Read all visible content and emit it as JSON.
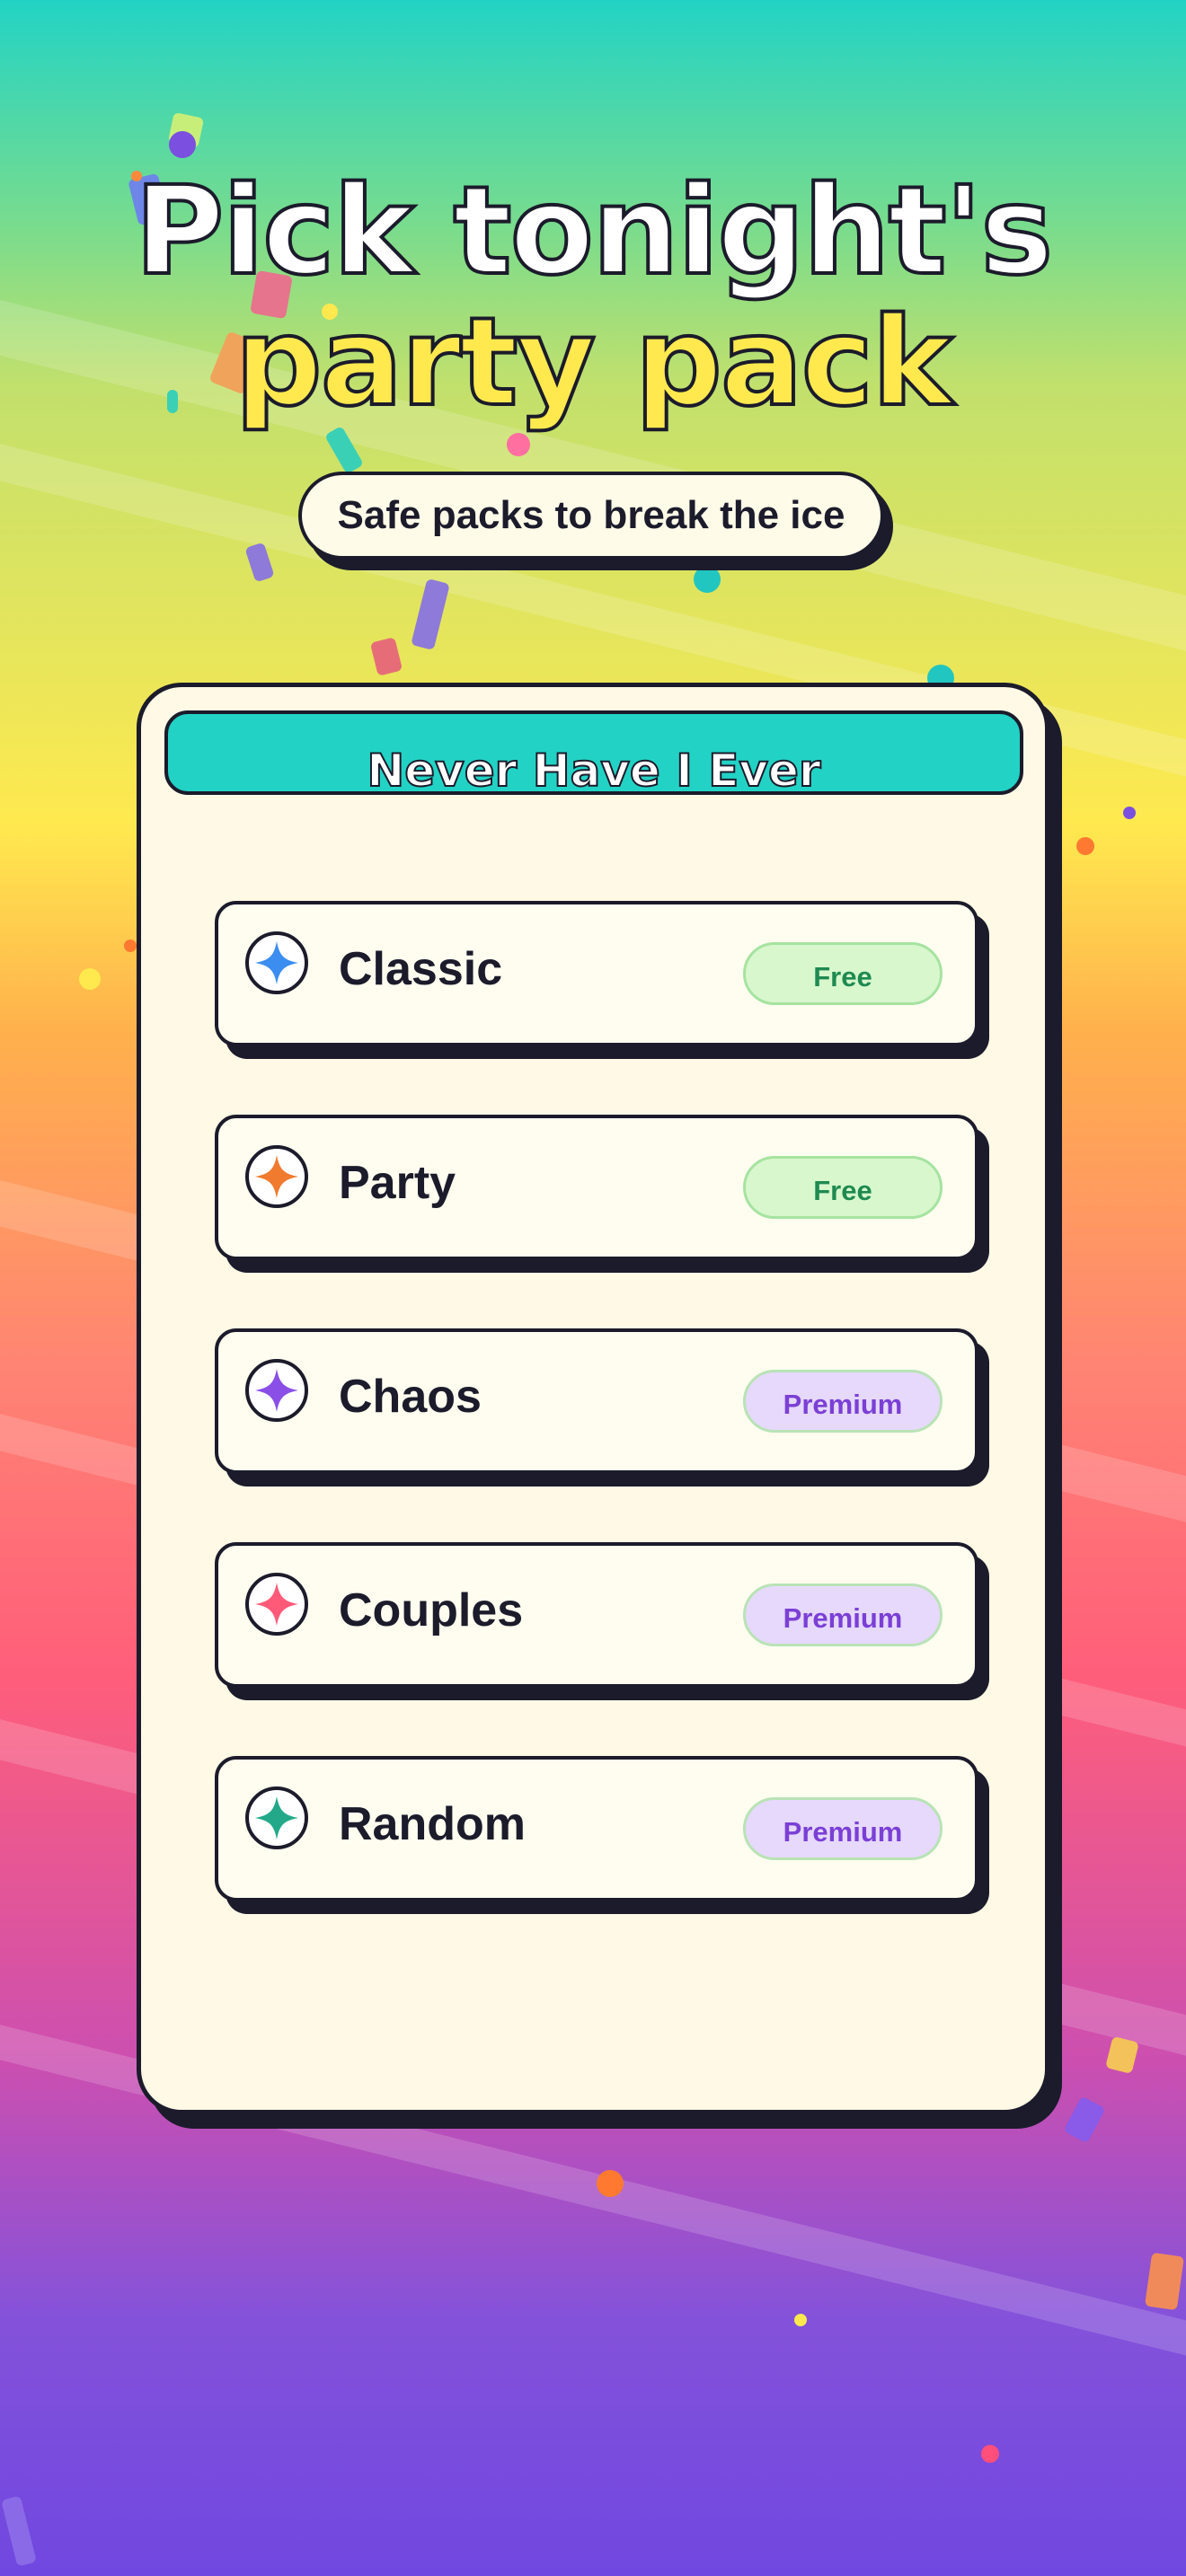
{
  "header": {
    "title_line1": "Pick tonight's",
    "title_line2": "party pack",
    "subtitle": "Safe packs to break the ice"
  },
  "panel": {
    "title": "Never Have I Ever"
  },
  "packs": [
    {
      "name": "Classic",
      "badge": "Free",
      "tier": "free",
      "icon": "sparkle-icon",
      "icon_color": "#3b8df0"
    },
    {
      "name": "Party",
      "badge": "Free",
      "tier": "free",
      "icon": "sparkle-icon",
      "icon_color": "#f07a2e"
    },
    {
      "name": "Chaos",
      "badge": "Premium",
      "tier": "premium",
      "icon": "sparkle-icon",
      "icon_color": "#8a4fe6"
    },
    {
      "name": "Couples",
      "badge": "Premium",
      "tier": "premium",
      "icon": "sparkle-icon",
      "icon_color": "#ff5a78"
    },
    {
      "name": "Random",
      "badge": "Premium",
      "tier": "premium",
      "icon": "sparkle-icon",
      "icon_color": "#23a989"
    }
  ],
  "colors": {
    "outline": "#1b1b2b",
    "panel_header": "#22d3c5",
    "title_accent": "#ffe94f",
    "free_badge_text": "#1f8a50",
    "premium_badge_text": "#7b3fd6"
  }
}
